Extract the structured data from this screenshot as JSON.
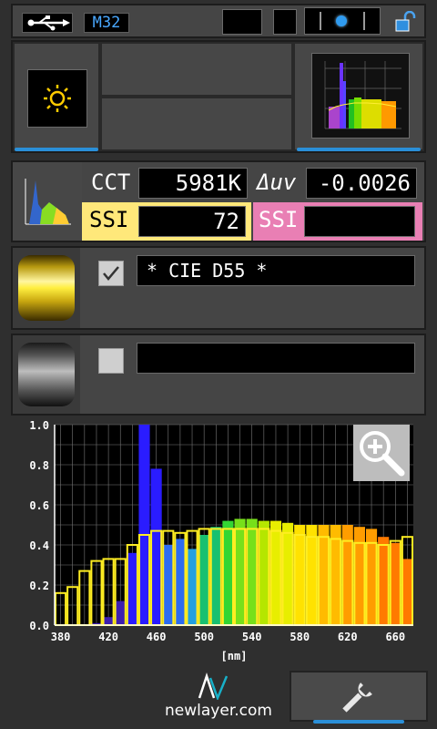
{
  "status_bar": {
    "usb_icon": "usb-icon",
    "memory": "M32",
    "lock_icon": "lock-open-icon"
  },
  "mode": {
    "light_icon": "sun-icon"
  },
  "readings": {
    "cct_label": "CCT",
    "cct_value": "5981K",
    "duv_label": "Δuv",
    "duv_value": "-0.0026",
    "ssi1_label": "SSI",
    "ssi1_value": "72",
    "ssi2_label": "SSI",
    "ssi2_value": ""
  },
  "references": [
    {
      "checked": true,
      "name": "* CIE D55 *",
      "color": "gold"
    },
    {
      "checked": false,
      "name": "",
      "color": "gray"
    }
  ],
  "chart_data": {
    "type": "bar",
    "xlabel": "[nm]",
    "x_ticks": [
      "380",
      "420",
      "460",
      "500",
      "540",
      "580",
      "620",
      "660"
    ],
    "y_ticks": [
      "0.0",
      "0.2",
      "0.4",
      "0.6",
      "0.8",
      "1.0"
    ],
    "ylim": [
      0,
      1.0
    ],
    "xlim": [
      375,
      675
    ],
    "measured": {
      "x": [
        380,
        390,
        400,
        410,
        420,
        430,
        440,
        450,
        460,
        470,
        480,
        490,
        500,
        510,
        520,
        530,
        540,
        550,
        560,
        570,
        580,
        590,
        600,
        610,
        620,
        630,
        640,
        650,
        660,
        670
      ],
      "values": [
        0.0,
        0.0,
        0.0,
        0.01,
        0.04,
        0.12,
        0.36,
        1.0,
        0.78,
        0.4,
        0.43,
        0.38,
        0.45,
        0.49,
        0.52,
        0.53,
        0.53,
        0.52,
        0.52,
        0.51,
        0.5,
        0.5,
        0.5,
        0.5,
        0.5,
        0.49,
        0.48,
        0.44,
        0.41,
        0.33
      ]
    },
    "reference": {
      "x": [
        380,
        390,
        400,
        410,
        420,
        430,
        440,
        450,
        460,
        470,
        480,
        490,
        500,
        510,
        520,
        530,
        540,
        550,
        560,
        570,
        580,
        590,
        600,
        610,
        620,
        630,
        640,
        650,
        660,
        670
      ],
      "values": [
        0.16,
        0.19,
        0.27,
        0.32,
        0.33,
        0.33,
        0.4,
        0.45,
        0.47,
        0.47,
        0.46,
        0.47,
        0.48,
        0.48,
        0.48,
        0.48,
        0.48,
        0.48,
        0.47,
        0.46,
        0.45,
        0.44,
        0.44,
        0.43,
        0.42,
        0.41,
        0.41,
        0.4,
        0.42,
        0.44
      ]
    }
  },
  "footer": {
    "brand": "newlayer.com",
    "tool_icon": "wrench-icon",
    "zoom_icon": "zoom-in-icon"
  }
}
